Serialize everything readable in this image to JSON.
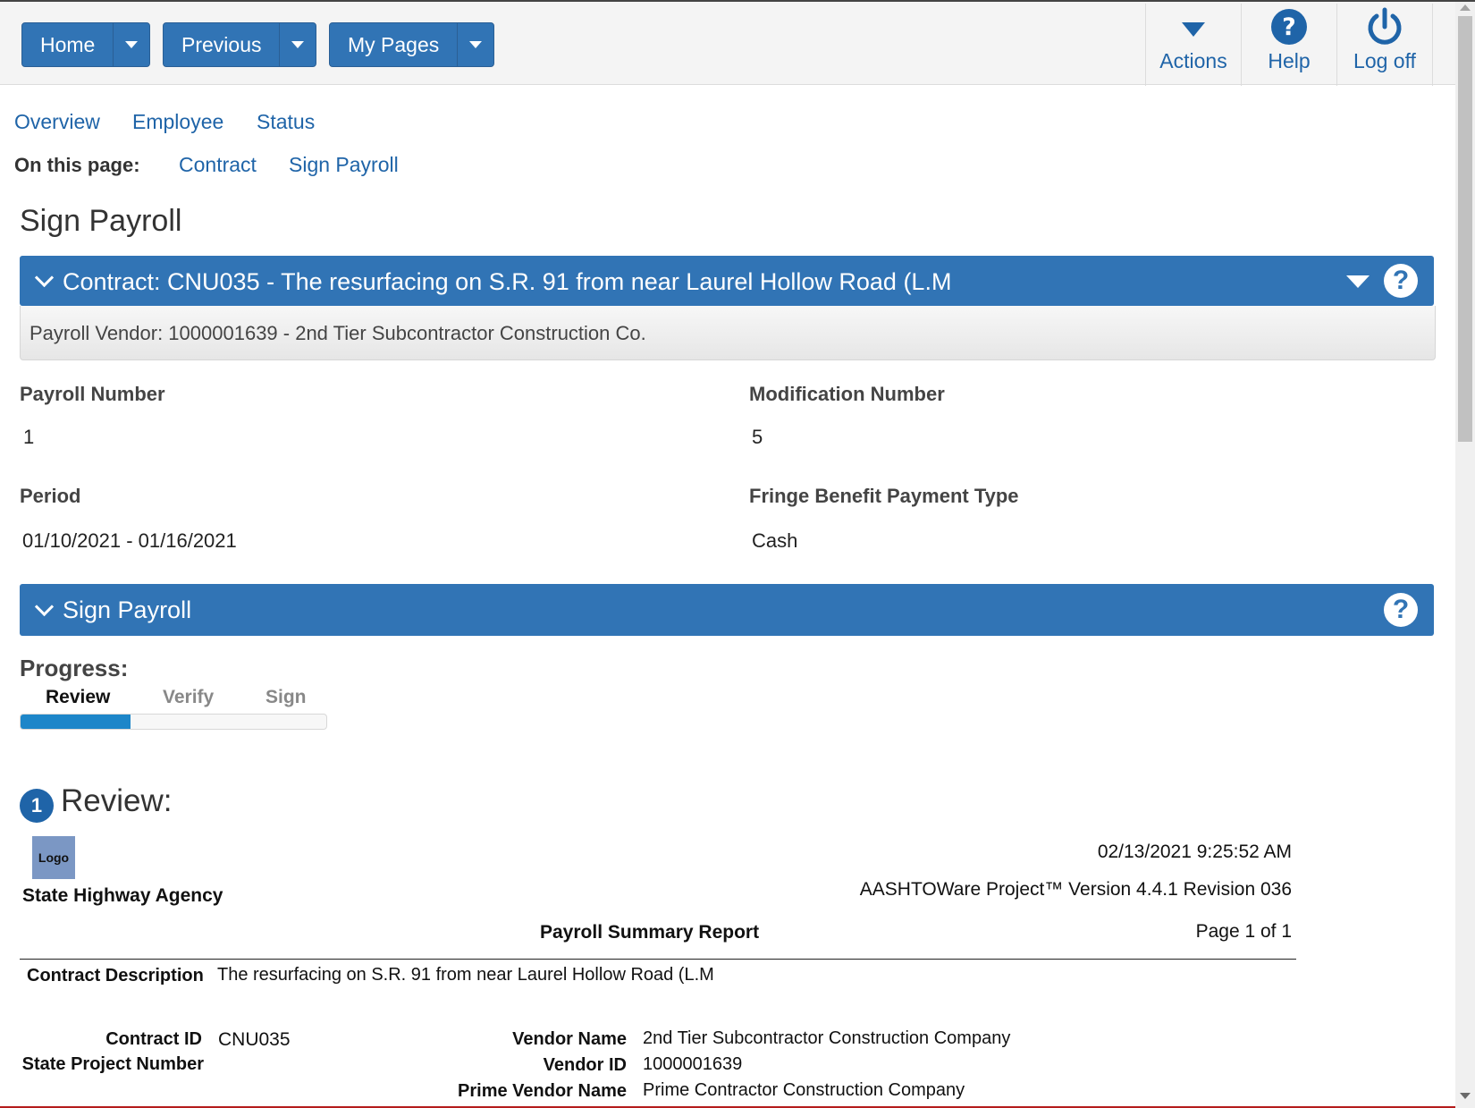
{
  "nav": {
    "home": "Home",
    "previous": "Previous",
    "my_pages": "My Pages",
    "actions": "Actions",
    "help": "Help",
    "log_off": "Log off"
  },
  "tabs": [
    "Overview",
    "Employee",
    "Status"
  ],
  "on_this_page": {
    "label": "On this page:",
    "links": [
      "Contract",
      "Sign Payroll"
    ]
  },
  "page_title": "Sign Payroll",
  "contract_panel": {
    "title": "Contract: CNU035 - The resurfacing on S.R. 91 from near Laurel Hollow Road (L.M",
    "subtitle": "Payroll Vendor: 1000001639 - 2nd Tier Subcontractor Construction Co."
  },
  "fields": {
    "payroll_number_label": "Payroll Number",
    "payroll_number": "1",
    "modification_number_label": "Modification Number",
    "modification_number": "5",
    "period_label": "Period",
    "period": "01/10/2021 - 01/16/2021",
    "fringe_label": "Fringe Benefit Payment Type",
    "fringe": "Cash"
  },
  "sign_panel": {
    "title": "Sign Payroll"
  },
  "progress": {
    "label": "Progress:",
    "steps": [
      "Review",
      "Verify",
      "Sign"
    ],
    "current_step": 1,
    "fraction_complete": 0.36
  },
  "review": {
    "step_number": "1",
    "title": "Review:"
  },
  "report": {
    "logo": "Logo",
    "agency": "State Highway Agency",
    "timestamp": "02/13/2021 9:25:52 AM",
    "version": "AASHTOWare Project™ Version 4.4.1 Revision 036",
    "report_title": "Payroll Summary Report",
    "page": "Page 1 of 1",
    "contract_description_label": "Contract Description",
    "contract_description": "The resurfacing on S.R. 91 from near Laurel Hollow Road (L.M",
    "contract_id_label": "Contract ID",
    "contract_id": "CNU035",
    "state_project_number_label": "State Project Number",
    "vendor_name_label": "Vendor Name",
    "vendor_name": "2nd Tier Subcontractor Construction Company",
    "vendor_id_label": "Vendor ID",
    "vendor_id": "1000001639",
    "prime_vendor_name_label": "Prime Vendor Name",
    "prime_vendor_name": "Prime Contractor Construction Company"
  },
  "colors": {
    "primary": "#3174b5",
    "link": "#1f64a8",
    "progress_fill": "#1d86c9"
  }
}
